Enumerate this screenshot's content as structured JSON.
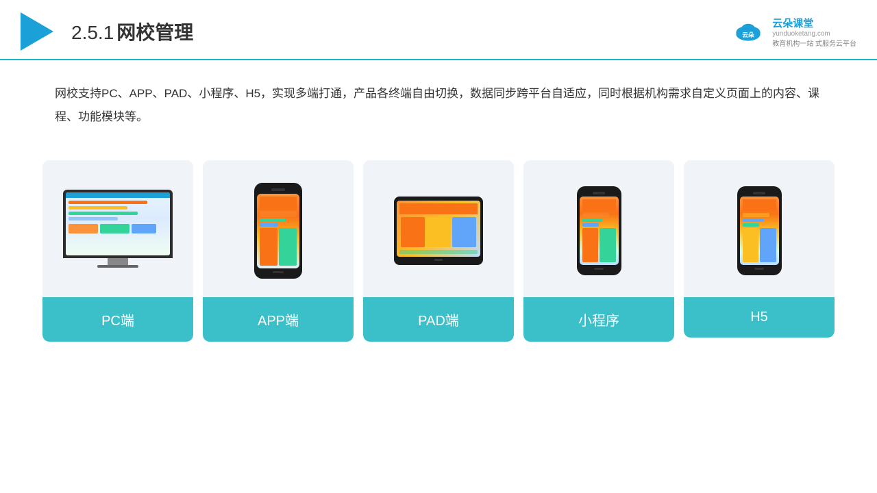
{
  "header": {
    "logo_alt": "play-triangle",
    "title_number": "2.5.1",
    "title_text": "网校管理",
    "brand_name": "云朵课堂",
    "brand_url": "yunduoketang.com",
    "brand_slogan_line1": "教育机构一站",
    "brand_slogan_line2": "式服务云平台"
  },
  "description": {
    "text": "网校支持PC、APP、PAD、小程序、H5，实现多端打通，产品各终端自由切换，数据同步跨平台自适应，同时根据机构需求自定义页面上的内容、课程、功能模块等。"
  },
  "cards": [
    {
      "id": "pc",
      "label": "PC端"
    },
    {
      "id": "app",
      "label": "APP端"
    },
    {
      "id": "pad",
      "label": "PAD端"
    },
    {
      "id": "miniprogram",
      "label": "小程序"
    },
    {
      "id": "h5",
      "label": "H5"
    }
  ],
  "colors": {
    "accent": "#1cb8c8",
    "teal": "#3bbfc8",
    "card_bg": "#eef2f7",
    "header_line": "#1cb8c8"
  }
}
